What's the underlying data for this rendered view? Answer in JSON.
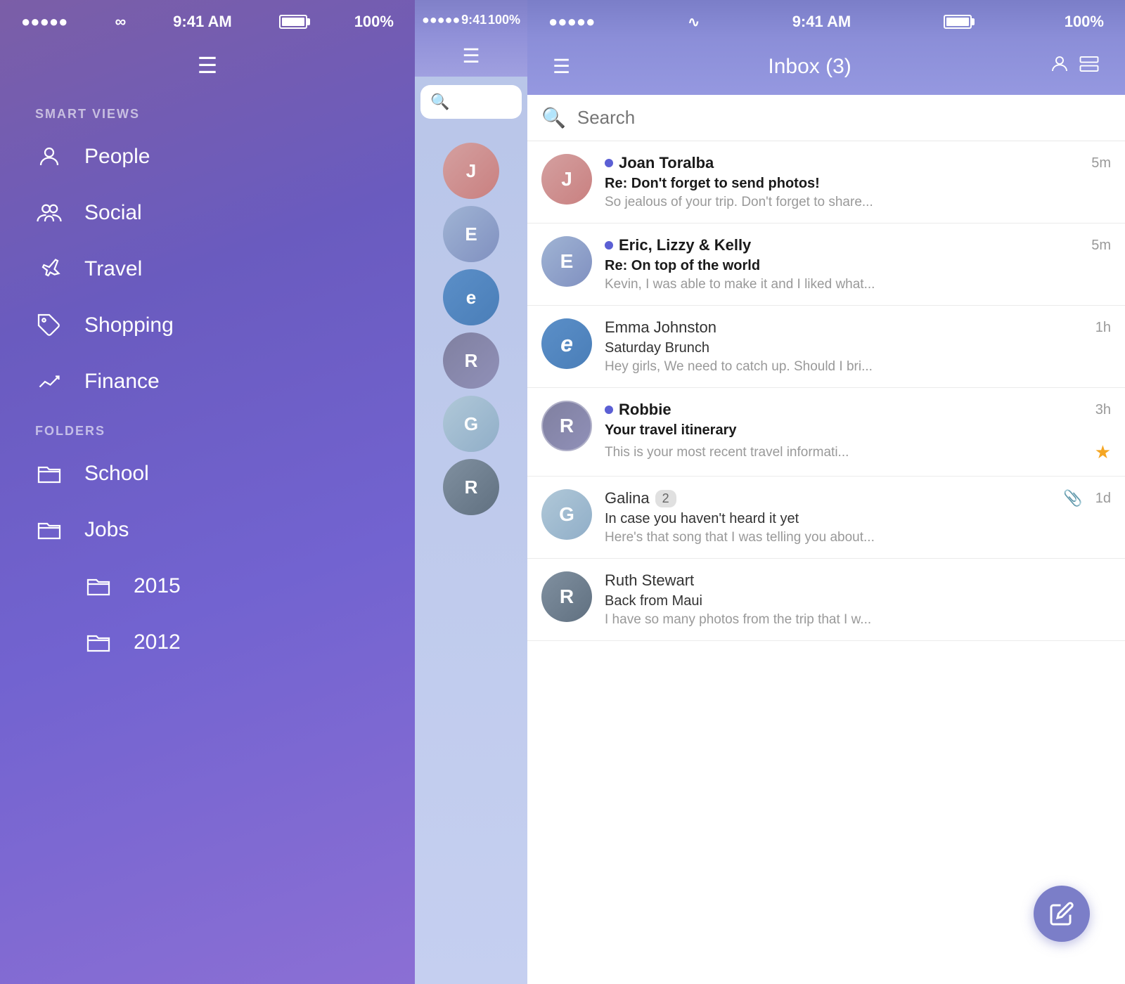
{
  "leftPhone": {
    "statusBar": {
      "signal": "●●●●●",
      "wifi": "wifi",
      "time": "9:41 AM",
      "batteryPct": "100%"
    },
    "hamburger": "☰",
    "sections": {
      "smartViews": {
        "label": "SMART VIEWS",
        "items": [
          {
            "id": "people",
            "label": "People",
            "icon": "person"
          },
          {
            "id": "social",
            "label": "Social",
            "icon": "people"
          },
          {
            "id": "travel",
            "label": "Travel",
            "icon": "plane"
          },
          {
            "id": "shopping",
            "label": "Shopping",
            "icon": "tag"
          },
          {
            "id": "finance",
            "label": "Finance",
            "icon": "chart"
          }
        ]
      },
      "folders": {
        "label": "FOLDERS",
        "items": [
          {
            "id": "school",
            "label": "School",
            "icon": "folder",
            "sub": false
          },
          {
            "id": "jobs",
            "label": "Jobs",
            "icon": "folder",
            "sub": false
          },
          {
            "id": "2015",
            "label": "2015",
            "icon": "folder",
            "sub": true
          },
          {
            "id": "2012",
            "label": "2012",
            "icon": "folder",
            "sub": true
          }
        ]
      }
    }
  },
  "rightPhone": {
    "statusBar": {
      "signal": "●●●●●",
      "wifi": "wifi",
      "time": "9:41 AM",
      "batteryPct": "100%"
    },
    "nav": {
      "menuIcon": "☰",
      "title": "Inbox (3)",
      "profileIcon": "person",
      "cardIcon": "card"
    },
    "search": {
      "placeholder": "Search"
    },
    "emails": [
      {
        "id": 1,
        "sender": "Joan Toralba",
        "unread": true,
        "time": "5m",
        "subject": "Re: Don't forget to send photos!",
        "preview": "So jealous of your trip. Don't forget to share...",
        "avatarClass": "av-joan",
        "avatarLetter": "J",
        "starred": false,
        "attachment": false,
        "badgeCount": null
      },
      {
        "id": 2,
        "sender": "Eric, Lizzy & Kelly",
        "unread": true,
        "time": "5m",
        "subject": "Re: On top of the world",
        "preview": "Kevin, I was able to make it and I liked what...",
        "avatarClass": "av-eric",
        "avatarLetter": "E",
        "starred": false,
        "attachment": false,
        "badgeCount": null
      },
      {
        "id": 3,
        "sender": "Emma Johnston",
        "unread": false,
        "time": "1h",
        "subject": "Saturday Brunch",
        "preview": "Hey girls, We need to catch up. Should I bri...",
        "avatarClass": "av-emma",
        "avatarLetter": "e",
        "starred": false,
        "attachment": false,
        "badgeCount": null
      },
      {
        "id": 4,
        "sender": "Robbie",
        "unread": true,
        "time": "3h",
        "subject": "Your travel itinerary",
        "preview": "This is your most recent travel informati...",
        "avatarClass": "av-robbie",
        "avatarLetter": "R",
        "starred": true,
        "attachment": false,
        "badgeCount": null
      },
      {
        "id": 5,
        "sender": "Galina",
        "unread": false,
        "time": "1d",
        "subject": "In case you haven't heard it yet",
        "preview": "Here's that song that I was telling you about...",
        "avatarClass": "av-galina",
        "avatarLetter": "G",
        "starred": false,
        "attachment": true,
        "badgeCount": "2"
      },
      {
        "id": 6,
        "sender": "Ruth Stewart",
        "unread": false,
        "time": "",
        "subject": "Back from Maui",
        "preview": "I have so many photos from the trip that I w...",
        "avatarClass": "av-ruth",
        "avatarLetter": "R",
        "starred": false,
        "attachment": false,
        "badgeCount": null
      }
    ],
    "composeLabel": "✏"
  }
}
